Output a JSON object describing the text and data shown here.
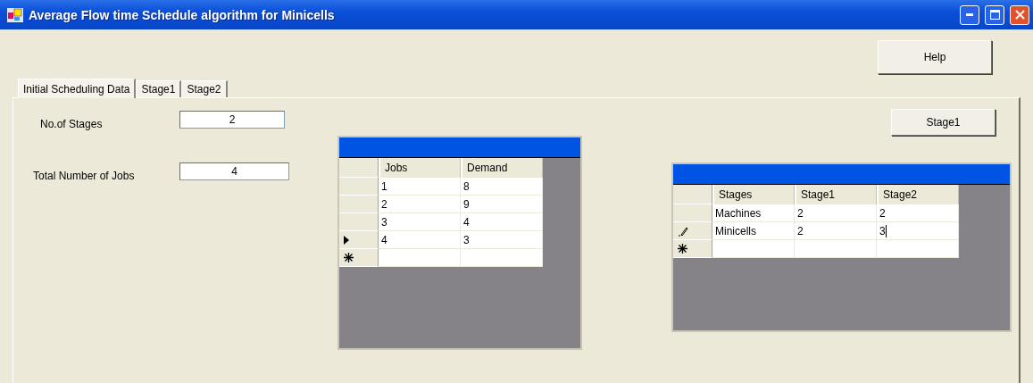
{
  "window": {
    "title": "Average Flow time Schedule algorithm for Minicells"
  },
  "help_button": "Help",
  "tabs": [
    {
      "label": "Initial Scheduling Data",
      "selected": true
    },
    {
      "label": "Stage1",
      "selected": false
    },
    {
      "label": "Stage2",
      "selected": false
    }
  ],
  "fields": [
    {
      "label": "No.of Stages",
      "value": "2"
    },
    {
      "label": "Total Number of Jobs",
      "value": "4"
    }
  ],
  "stage_button": "Stage1",
  "grids": [
    {
      "columns": [
        "Jobs",
        "Demand"
      ],
      "new_row": true,
      "rows": [
        {
          "cells": [
            "1",
            "8"
          ],
          "selected": false,
          "editing": false
        },
        {
          "cells": [
            "2",
            "9"
          ],
          "selected": false,
          "editing": false
        },
        {
          "cells": [
            "3",
            "4"
          ],
          "selected": false,
          "editing": false
        },
        {
          "cells": [
            "4",
            "3"
          ],
          "selected": true,
          "editing": false
        }
      ]
    },
    {
      "columns": [
        "Stages",
        "Stage1",
        "Stage2"
      ],
      "new_row": true,
      "rows": [
        {
          "cells": [
            "Machines",
            "2",
            "2"
          ],
          "selected": false,
          "editing": false
        },
        {
          "cells": [
            "Minicells",
            "2",
            "3"
          ],
          "selected": false,
          "editing": true
        }
      ]
    }
  ]
}
